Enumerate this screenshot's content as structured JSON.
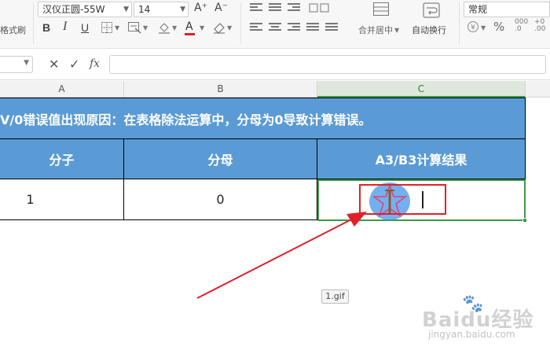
{
  "ribbon": {
    "format_painter_label": "格式刷",
    "font_name": "汉仪正圆-55W",
    "font_size": "14",
    "increase_font_glyph": "A⁺",
    "decrease_font_glyph": "A⁻",
    "bold_label": "B",
    "italic_label": "I",
    "underline_label": "U",
    "merge_center_label": "合并居中",
    "wrap_text_label": "自动换行",
    "number_format": "常规",
    "percent_label": "%",
    "font_color": "#e0202a"
  },
  "formula_bar": {
    "cancel_glyph": "✕",
    "confirm_glyph": "✓",
    "fx_label": "fx",
    "value": ""
  },
  "sheet": {
    "columns": [
      "A",
      "B",
      "C"
    ],
    "title": "V/0错误值出现原因：在表格除法运算中，分母为0导致计算错误。",
    "headers": [
      "分子",
      "分母",
      "A3/B3计算结果"
    ],
    "row3": [
      "1",
      "0",
      ""
    ],
    "header_color": "#5b9bd5",
    "selection_color": "#3c9a47",
    "annotation_color": "#e0202a"
  },
  "overlay": {
    "gif_label": "1.gif",
    "watermark_main": "Baidu经验",
    "watermark_sub": "jingyan.baidu.com"
  }
}
